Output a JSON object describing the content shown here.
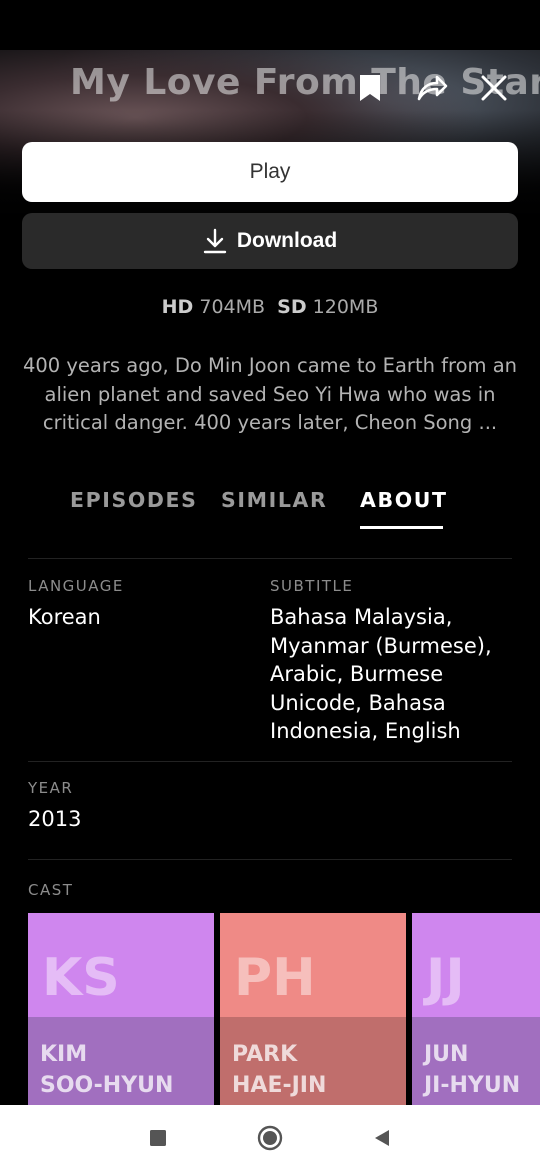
{
  "show": {
    "title": "My Love From The Star"
  },
  "actions": {
    "play_label": "Play",
    "download_label": "Download"
  },
  "sizes": {
    "hd_label": "HD",
    "hd_size": "704MB",
    "sd_label": "SD",
    "sd_size": "120MB"
  },
  "synopsis": "400 years ago, Do Min Joon came to Earth from an alien planet and saved Seo Yi Hwa who was in critical danger. 400 years later, Cheon Song ...",
  "tabs": [
    {
      "label": "EPISODES",
      "active": false
    },
    {
      "label": "SIMILAR",
      "active": false
    },
    {
      "label": "ABOUT",
      "active": true
    }
  ],
  "about": {
    "language_label": "LANGUAGE",
    "language_value": "Korean",
    "subtitle_label": "SUBTITLE",
    "subtitle_value": "Bahasa Malaysia, Myanmar (Burmese), Arabic, Burmese Unicode, Bahasa Indonesia, English",
    "year_label": "YEAR",
    "year_value": "2013",
    "cast_label": "CAST"
  },
  "cast": [
    {
      "initials": "KS",
      "name": "KIM\nSOO-HYUN",
      "color_top": "#cf86ee",
      "color_bottom": "#a16fbf"
    },
    {
      "initials": "PH",
      "name": "PARK\nHAE-JIN",
      "color_top": "#ef8a86",
      "color_bottom": "#c06e6c"
    },
    {
      "initials": "JJ",
      "name": "JUN\nJI-HYUN",
      "color_top": "#cf86ee",
      "color_bottom": "#a16fbf"
    }
  ],
  "icons": {
    "bookmark": "bookmark-icon",
    "share": "share-icon",
    "close": "close-icon",
    "download": "download-icon",
    "nav_recents": "square-icon",
    "nav_home": "circle-icon",
    "nav_back": "triangle-back-icon"
  }
}
